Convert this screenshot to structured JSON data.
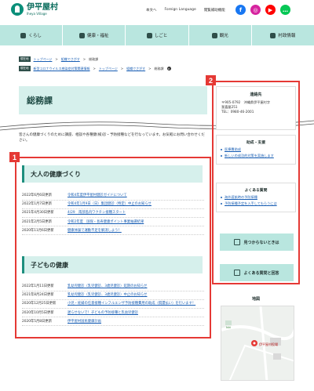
{
  "header": {
    "logo_name": "伊平屋村",
    "logo_sub": "Iheya Village",
    "util_links": [
      "本文へ",
      "Foreign Language",
      "閲覧補助機能"
    ],
    "social": [
      {
        "icon": "facebook-icon",
        "glyph": "f"
      },
      {
        "icon": "instagram-icon",
        "glyph": "◎"
      },
      {
        "icon": "youtube-icon",
        "glyph": "▶"
      },
      {
        "icon": "line-icon",
        "glyph": "…"
      }
    ]
  },
  "nav": [
    "くらし",
    "健康・福祉",
    "しごと",
    "観光",
    "村政情報"
  ],
  "breadcrumb1": {
    "tag": "現在地",
    "items": [
      "トップページ",
      "組織でさがす",
      "総務課"
    ]
  },
  "breadcrumb2": {
    "tag": "現在地",
    "items": [
      "新型コロナウイルス感染症対策関連情報",
      "トップページ",
      "組織でさがす",
      "総務課"
    ]
  },
  "page_title": "総務課",
  "intro": "皆さんの健康づくりのために講座、相談や各種健(検)診・予防接種などを行なっています。お気軽にお問い合わせください。",
  "badges": {
    "one": "1",
    "two": "2"
  },
  "adult": {
    "heading": "大人の健康づくり",
    "items": [
      {
        "date": "2022年6月6日更新",
        "title": "令和4年度伊平屋村健診ガイドについて"
      },
      {
        "date": "2022年1月7日更新",
        "title": "令和4年1月9日（日）集団健診（特定）中止のお知らせ"
      },
      {
        "date": "2021年4月30日更新",
        "title": "4/29　南部島内ワクチン接種スタート"
      },
      {
        "date": "2021年2月5日更新",
        "title": "令和2年度　国保・長寿健康ポイント事業抽選結果"
      },
      {
        "date": "2020年11月6日更新",
        "title": "健康体操で運動不足を解消しよう！"
      }
    ]
  },
  "child": {
    "heading": "子どもの健康",
    "items": [
      {
        "date": "2022年1月11日更新",
        "title": "乳幼児健診（乳児健診、3歳児健診）延期のお知らせ"
      },
      {
        "date": "2021年8月24日更新",
        "title": "乳幼児健診（乳児健診、3歳児健診）中止のお知らせ"
      },
      {
        "date": "2020年12月25日更新",
        "title": "小児・妊婦の任意接種インフルエンザ予防接種費用の助成（償還払い）を行います！"
      },
      {
        "date": "2020年10月5日更新",
        "title": "遅らせないで！子どもの予防接種と乳幼児健診"
      },
      {
        "date": "2020年5月8日更新",
        "title": "伊平屋村国民健康計画"
      }
    ]
  },
  "contact": {
    "heading": "連絡先",
    "lines": [
      "〒905-0792　沖縄県伊平屋村字",
      "我喜屋251",
      "TEL：0980-46-2001"
    ]
  },
  "support": {
    "heading": "助成・支援",
    "items": [
      "医療費助成",
      "新しいの成功的対策を実施します"
    ]
  },
  "faq": {
    "heading": "よくある質問",
    "items": [
      "海外渡航時の予防接種",
      "予防接種予定を入手してもらうには"
    ]
  },
  "buttons": {
    "not_found": "見つからないときは",
    "faq": "よくある質問と回答"
  },
  "map": {
    "title": "地図",
    "pin_label": "伊平屋村役場",
    "road_label": "Ishi"
  }
}
